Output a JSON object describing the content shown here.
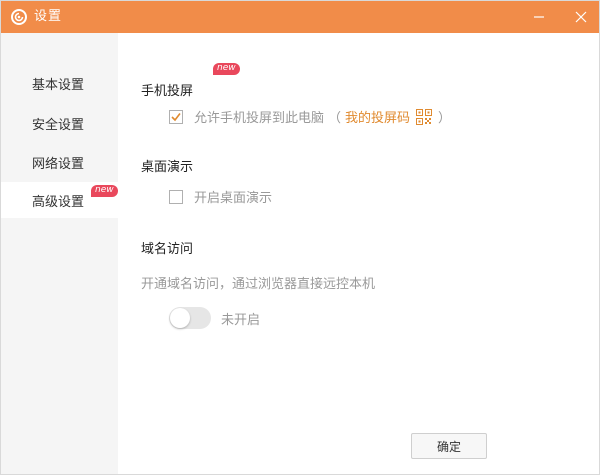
{
  "window": {
    "title": "设置"
  },
  "sidebar": {
    "items": [
      {
        "label": "基本设置"
      },
      {
        "label": "安全设置"
      },
      {
        "label": "网络设置"
      },
      {
        "label": "高级设置",
        "badge": "new",
        "active": true
      }
    ]
  },
  "main": {
    "screen_projection": {
      "title": "手机投屏",
      "badge": "new",
      "option": {
        "label": "允许手机投屏到此电脑",
        "checked": true,
        "paren_open": "（",
        "link": "我的投屏码",
        "paren_close": "）"
      }
    },
    "desktop_demo": {
      "title": "桌面演示",
      "option": {
        "label": "开启桌面演示",
        "checked": false
      }
    },
    "domain_access": {
      "title": "域名访问",
      "description": "开通域名访问，通过浏览器直接远控本机",
      "toggle": {
        "on": false,
        "label": "未开启"
      }
    },
    "bottom_button": {
      "label": "确定"
    }
  },
  "colors": {
    "titlebar": "#f18c49",
    "accent": "#e08a2f",
    "badge": "#e9485c"
  },
  "icons": {
    "app": "logo-icon",
    "minimize": "minimize-icon",
    "close": "close-icon",
    "check": "check-icon",
    "qr": "qr-code-icon"
  }
}
